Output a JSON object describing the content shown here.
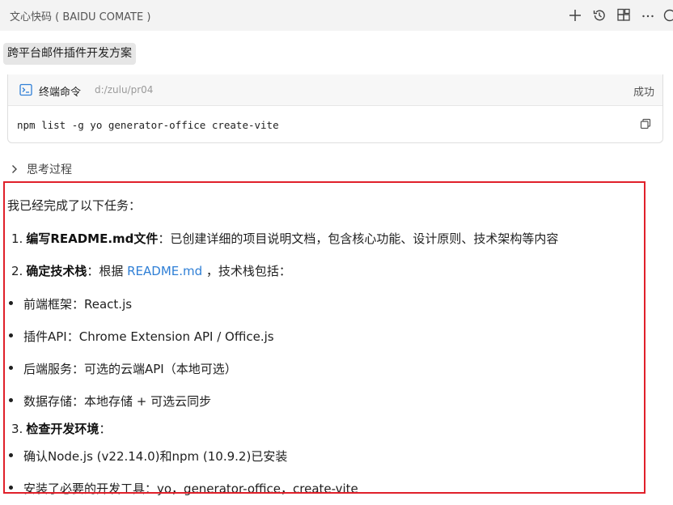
{
  "header": {
    "app_title": "文心快码 ( BAIDU COMATE )",
    "actions": [
      "plus-icon",
      "history-icon",
      "extensions-icon",
      "more-icon",
      "info-icon"
    ]
  },
  "session": {
    "title": "跨平台邮件插件开发方案"
  },
  "terminal": {
    "label": "终端命令",
    "path": "d:/zulu/pr04",
    "status": "成功",
    "command": "npm list -g yo generator-office create-vite"
  },
  "thinking": {
    "label": "思考过程"
  },
  "message": {
    "intro": "我已经完成了以下任务：",
    "item1": {
      "num": "1.",
      "bold": "编写README.md文件",
      "rest": "：已创建详细的项目说明文档，包含核心功能、设计原则、技术架构等内容"
    },
    "item2": {
      "num": "2.",
      "bold": "确定技术栈",
      "pre": "：根据 ",
      "link": "README.md",
      "post": " ，技术栈包括："
    },
    "bullets_a": [
      "前端框架：React.js",
      "插件API：Chrome Extension API / Office.js",
      "后端服务：可选的云端API（本地可选）",
      "数据存储：本地存储 + 可选云同步"
    ],
    "item3": {
      "num": "3.",
      "bold": "检查开发环境",
      "rest": "："
    },
    "bullets_b": [
      "确认Node.js (v22.14.0)和npm (10.9.2)已安装",
      "安装了必要的开发工具：yo，generator-office，create-vite"
    ]
  },
  "colors": {
    "highlight": "#e0202a",
    "link": "#2f7fd6",
    "titlebar": "#f3f3f3"
  }
}
